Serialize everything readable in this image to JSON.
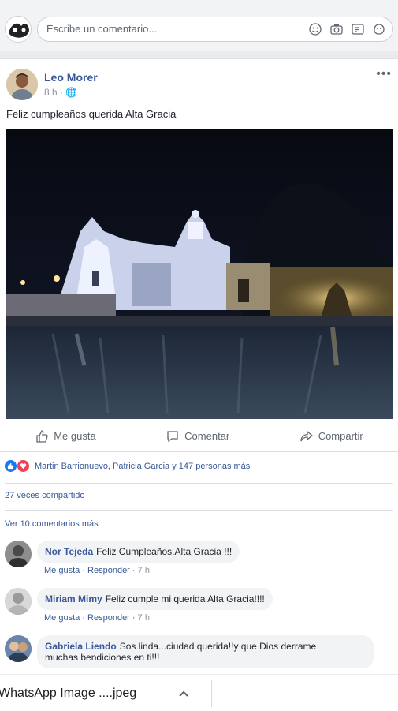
{
  "composer": {
    "placeholder": "Escribe un comentario...",
    "icons": [
      "emoji-icon",
      "camera-icon",
      "gif-icon",
      "sticker-icon"
    ]
  },
  "post": {
    "author": "Leo Morer",
    "meta": "8 h · 🌐",
    "more": "•••",
    "text": "Feliz cumpleaños querida Alta Gracia",
    "photo_subject": "night-church-photo"
  },
  "actions": {
    "like": "Me gusta",
    "comment": "Comentar",
    "share": "Compartir"
  },
  "reactions": {
    "names": "Martin Barrionuevo, Patricia Garcia y 147 personas más"
  },
  "shares": "27 veces compartido",
  "more_comments": "Ver 10 comentarios más",
  "comments": [
    {
      "name": "Nor Tejeda",
      "text": "Feliz Cumpleaños.Alta Gracia !!!",
      "like": "Me gusta",
      "reply": "Responder",
      "time": "7 h"
    },
    {
      "name": "Miriam Mimy",
      "text": "Feliz cumple mi querida Alta Gracia!!!!",
      "like": "Me gusta",
      "reply": "Responder",
      "time": "7 h"
    },
    {
      "name": "Gabriela Liendo",
      "text": "Sos linda...ciudad querida!!y que Dios derrame",
      "text2": "muchas bendiciones en ti!!!"
    }
  ],
  "download": {
    "filename": "WhatsApp Image ....jpeg"
  }
}
